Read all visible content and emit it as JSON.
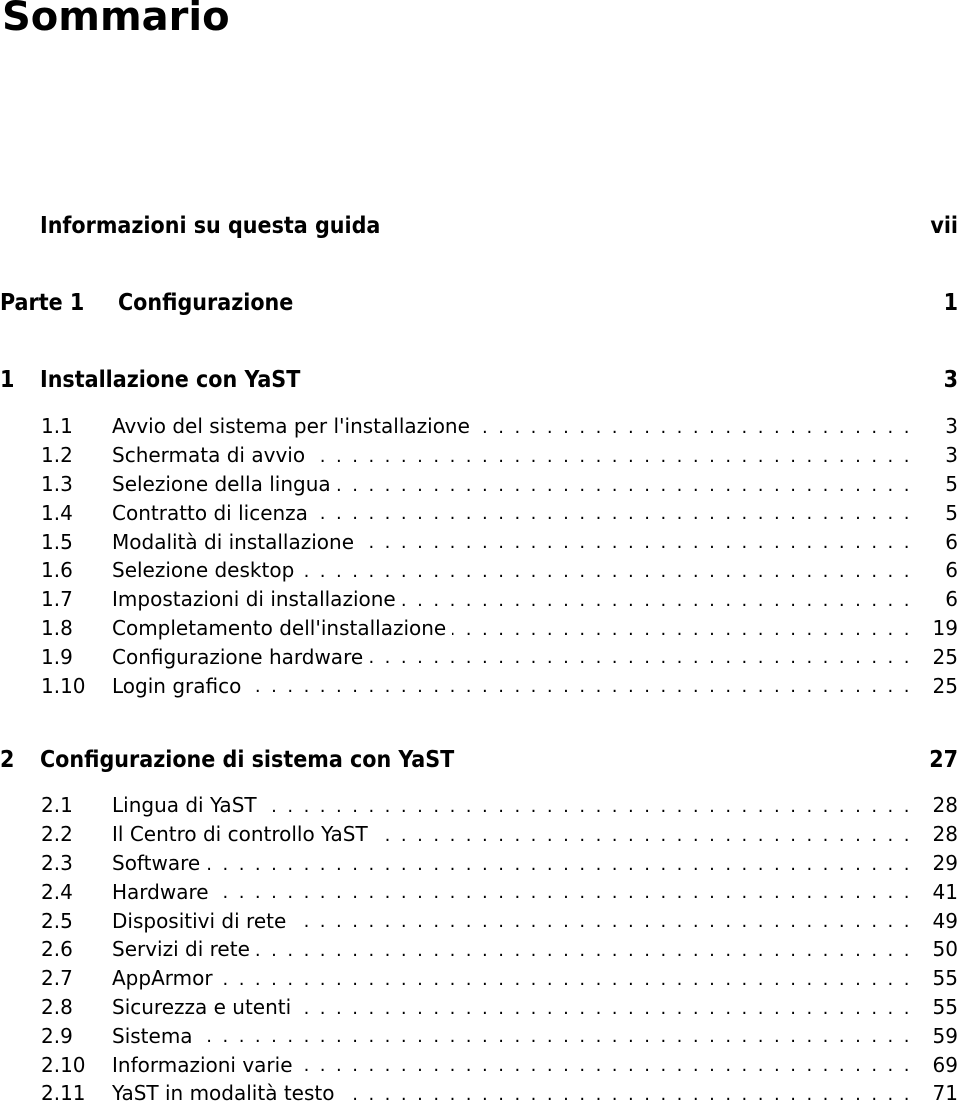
{
  "title": "Sommario",
  "front_matter": {
    "label": "Informazioni su questa guida",
    "page": "vii"
  },
  "part": {
    "number": "Parte 1",
    "label": "Configurazione",
    "page": "1"
  },
  "chapters": [
    {
      "number": "1",
      "label": "Installazione con YaST",
      "page": "3",
      "sections": [
        {
          "number": "1.1",
          "label": "Avvio del sistema per l'installazione",
          "page": "3"
        },
        {
          "number": "1.2",
          "label": "Schermata di avvio",
          "page": "3"
        },
        {
          "number": "1.3",
          "label": "Selezione della lingua",
          "page": "5"
        },
        {
          "number": "1.4",
          "label": "Contratto di licenza",
          "page": "5"
        },
        {
          "number": "1.5",
          "label": "Modalità di installazione",
          "page": "6"
        },
        {
          "number": "1.6",
          "label": "Selezione desktop",
          "page": "6"
        },
        {
          "number": "1.7",
          "label": "Impostazioni di installazione",
          "page": "6"
        },
        {
          "number": "1.8",
          "label": "Completamento dell'installazione",
          "page": "19"
        },
        {
          "number": "1.9",
          "label": "Configurazione hardware",
          "page": "25"
        },
        {
          "number": "1.10",
          "label": "Login grafico",
          "page": "25"
        }
      ]
    },
    {
      "number": "2",
      "label": "Configurazione di sistema con YaST",
      "page": "27",
      "sections": [
        {
          "number": "2.1",
          "label": "Lingua di YaST",
          "page": "28"
        },
        {
          "number": "2.2",
          "label": "Il Centro di controllo YaST",
          "page": "28"
        },
        {
          "number": "2.3",
          "label": "Software",
          "page": "29"
        },
        {
          "number": "2.4",
          "label": "Hardware",
          "page": "41"
        },
        {
          "number": "2.5",
          "label": "Dispositivi di rete",
          "page": "49"
        },
        {
          "number": "2.6",
          "label": "Servizi di rete",
          "page": "50"
        },
        {
          "number": "2.7",
          "label": "AppArmor",
          "page": "55"
        },
        {
          "number": "2.8",
          "label": "Sicurezza e utenti",
          "page": "55"
        },
        {
          "number": "2.9",
          "label": "Sistema",
          "page": "59"
        },
        {
          "number": "2.10",
          "label": "Informazioni varie",
          "page": "69"
        },
        {
          "number": "2.11",
          "label": "YaST in modalità testo",
          "page": "71"
        }
      ]
    }
  ],
  "leader_char": "."
}
